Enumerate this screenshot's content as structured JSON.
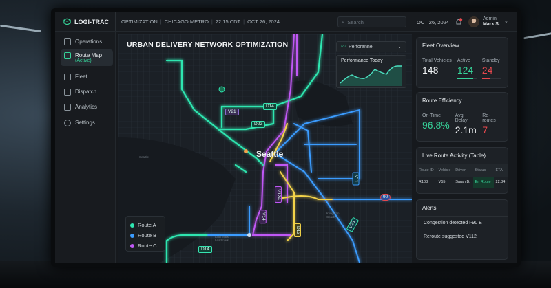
{
  "header": {
    "app_name": "LOGI-TRAC",
    "crumbs": [
      "OPTIMIZATION",
      "CHICAGO METRO",
      "22:15 CDT",
      "OCT 26, 2024"
    ],
    "search_placeholder": "Search",
    "date": "OCT 26, 2024",
    "user_role": "Admin",
    "user_name": "Mark S."
  },
  "sidebar": {
    "items": [
      {
        "label": "Operations"
      },
      {
        "label": "Route Map",
        "sub": "(Active)"
      },
      {
        "label": "Fleet"
      },
      {
        "label": "Dispatch"
      },
      {
        "label": "Analytics"
      },
      {
        "label": "Settings"
      }
    ]
  },
  "map": {
    "title": "URBAN DELIVERY NETWORK OPTIMIZATION",
    "city": "Seattle",
    "performance_select": "Perforanne",
    "performance_card_title": "Performance Today",
    "vehicle_labels": [
      "D14",
      "D22",
      "V21",
      "D14",
      "V23",
      "V14",
      "V12A",
      "V14",
      "D13",
      "V11"
    ],
    "place_labels": [
      "Seattle",
      "Lath Mark Leadmark",
      "Klingston Courts"
    ],
    "legend": [
      {
        "label": "Route A",
        "color": "#2ee6b0"
      },
      {
        "label": "Route B",
        "color": "#3b9cff"
      },
      {
        "label": "Route C",
        "color": "#c058f5"
      }
    ],
    "highway": "90"
  },
  "fleet": {
    "title": "Fleet Overview",
    "total_label": "Total Vehicles",
    "total": "148",
    "active_label": "Active",
    "active": "124",
    "standby_label": "Standby",
    "standby": "24",
    "active_fraction": 0.84,
    "standby_fraction": 0.16
  },
  "efficiency": {
    "title": "Route Efficiency",
    "ontime_label": "On-Time",
    "ontime": "96.8%",
    "delay_label": "Avg. Delay",
    "delay": "2.1m",
    "reroutes_label": "Re-routes",
    "reroutes": "7"
  },
  "activity": {
    "title": "Live Route Activity (Table)",
    "columns": [
      "Route ID",
      "Vehicle",
      "Driver",
      "Status",
      "ETA"
    ],
    "rows": [
      [
        "R103",
        "V55",
        "Sarah B.",
        "En Route",
        "22:34"
      ]
    ]
  },
  "alerts": {
    "title": "Alerts",
    "items": [
      "Congestion detected I-90 E",
      "Reroute suggested V112"
    ]
  },
  "colors": {
    "accent": "#36d399",
    "danger": "#e5484d",
    "routeA": "#2ee6b0",
    "routeB": "#3b9cff",
    "routeC": "#c058f5",
    "routeD": "#f3d34a"
  }
}
